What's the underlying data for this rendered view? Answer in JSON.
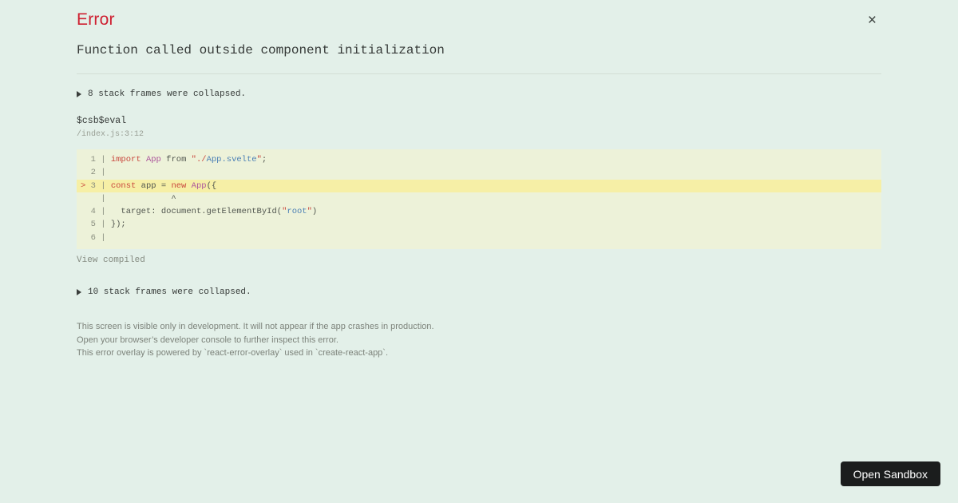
{
  "overlay": {
    "title": "Error",
    "close_label": "×",
    "message": "Function called outside component initialization",
    "collapsed_top": "8 stack frames were collapsed.",
    "frame": {
      "function_name": "$csb$eval",
      "location": "/index.js:3:12"
    },
    "code_frame": {
      "lines": [
        {
          "num": "1",
          "marked": false,
          "tokens": [
            {
              "t": "kw",
              "v": "import"
            },
            {
              "t": "pl",
              "v": " "
            },
            {
              "t": "cls",
              "v": "App"
            },
            {
              "t": "pl",
              "v": " from "
            },
            {
              "t": "str",
              "v": "\"./"
            },
            {
              "t": "mod",
              "v": "App.svelte"
            },
            {
              "t": "str",
              "v": "\""
            },
            {
              "t": "pl",
              "v": ";"
            }
          ]
        },
        {
          "num": "2",
          "marked": false,
          "tokens": []
        },
        {
          "num": "3",
          "marked": true,
          "tokens": [
            {
              "t": "kw",
              "v": "const"
            },
            {
              "t": "pl",
              "v": " app = "
            },
            {
              "t": "kw",
              "v": "new"
            },
            {
              "t": "pl",
              "v": " "
            },
            {
              "t": "cls",
              "v": "App"
            },
            {
              "t": "pl",
              "v": "({"
            }
          ]
        },
        {
          "caret": true,
          "text": "            ^"
        },
        {
          "num": "4",
          "marked": false,
          "tokens": [
            {
              "t": "pl",
              "v": "  target: document.getElementById("
            },
            {
              "t": "str",
              "v": "\""
            },
            {
              "t": "mod",
              "v": "root"
            },
            {
              "t": "str",
              "v": "\""
            },
            {
              "t": "pl",
              "v": ")"
            }
          ]
        },
        {
          "num": "5",
          "marked": false,
          "tokens": [
            {
              "t": "pl",
              "v": "});"
            }
          ]
        },
        {
          "num": "6",
          "marked": false,
          "tokens": []
        }
      ]
    },
    "view_compiled_label": "View compiled",
    "collapsed_bottom": "10 stack frames were collapsed.",
    "footer_lines": [
      "This screen is visible only in development. It will not appear if the app crashes in production.",
      "Open your browser’s developer console to further inspect this error.",
      "This error overlay is powered by `react-error-overlay` used in `create-react-app`."
    ]
  },
  "open_sandbox_button": {
    "label": "Open Sandbox"
  },
  "colors": {
    "page_background": "#e3f0e9",
    "title_red": "#ce2031",
    "text_dark": "#363a38",
    "muted_gray": "#9aa096",
    "code_background": "#edf2d9",
    "code_marked_line": "#f6efa6",
    "syntax_keyword": "#c9473d",
    "syntax_class": "#ac569c",
    "syntax_module": "#4a7fb5",
    "button_background": "#1b1d1d",
    "button_text": "#ffffff"
  }
}
